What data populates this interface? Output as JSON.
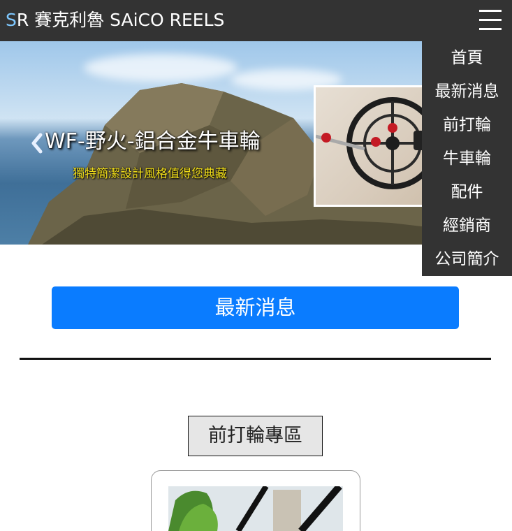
{
  "header": {
    "brand_initial": "S",
    "brand_rest": "R 賽克利魯 SAiCO REELS"
  },
  "banner": {
    "title": "WF-野火-鋁合金牛車輪",
    "subtitle": "獨特簡潔設計風格值得您典藏"
  },
  "menu": {
    "items": [
      {
        "label": "首頁"
      },
      {
        "label": "最新消息"
      },
      {
        "label": "前打輪"
      },
      {
        "label": "牛車輪"
      },
      {
        "label": "配件"
      },
      {
        "label": "經銷商"
      },
      {
        "label": "公司簡介"
      }
    ]
  },
  "main": {
    "news_button": "最新消息",
    "section_label": "前打輪專區"
  },
  "colors": {
    "topbar": "#333333",
    "accent": "#0a7cff",
    "subtitle": "#f4e01a"
  },
  "icons": {
    "menu": "hamburger-icon",
    "prev": "chevron-left-icon"
  }
}
